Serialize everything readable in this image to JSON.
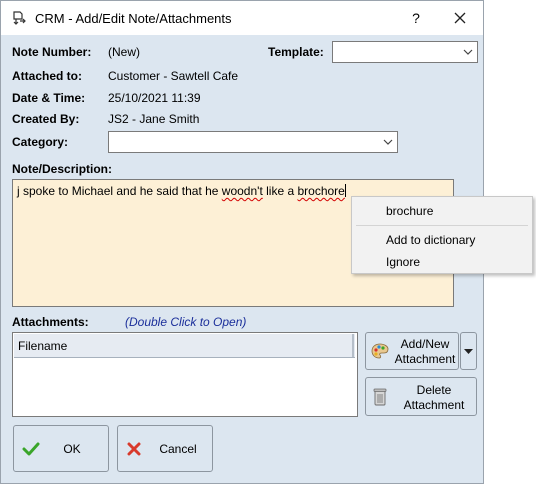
{
  "window": {
    "title": "CRM - Add/Edit Note/Attachments",
    "help_label": "?"
  },
  "fields": {
    "note_number_label": "Note Number:",
    "note_number_value": "(New)",
    "template_label": "Template:",
    "template_value": "",
    "attached_to_label": "Attached to:",
    "attached_to_value": "Customer - Sawtell Cafe",
    "date_time_label": "Date & Time:",
    "date_time_value": "25/10/2021 11:39",
    "created_by_label": "Created By:",
    "created_by_value": "JS2 - Jane Smith",
    "category_label": "Category:",
    "category_value": "",
    "note_label": "Note/Description:"
  },
  "note": {
    "text_before": "j spoke to Michael and he said that he ",
    "word1": "woodn't",
    "text_mid": " like a ",
    "word2": "brochore"
  },
  "context_menu": {
    "suggestion": "brochure",
    "add_to_dictionary": "Add to dictionary",
    "ignore": "Ignore"
  },
  "attachments": {
    "label": "Attachments:",
    "hint": "(Double Click to Open)",
    "columns": [
      "Filename"
    ],
    "rows": []
  },
  "buttons": {
    "add_new_line1": "Add/New",
    "add_new_line2": "Attachment",
    "delete_line1": "Delete",
    "delete_line2": "Attachment",
    "ok": "OK",
    "cancel": "Cancel"
  },
  "colors": {
    "dialog_bg": "#dce6f0",
    "memo_bg": "#fdf0d6",
    "hint_text": "#1a2e9a",
    "spell_underline": "#d20000",
    "ok_check": "#3aa52a",
    "cancel_x": "#d83a2c"
  },
  "icons": {
    "title": "crm-app-icon",
    "close": "close-icon",
    "dropdown": "chevron-down-icon",
    "add_attachment": "palette-icon",
    "delete_attachment": "trash-icon",
    "ok": "checkmark-icon",
    "cancel": "cross-icon"
  }
}
